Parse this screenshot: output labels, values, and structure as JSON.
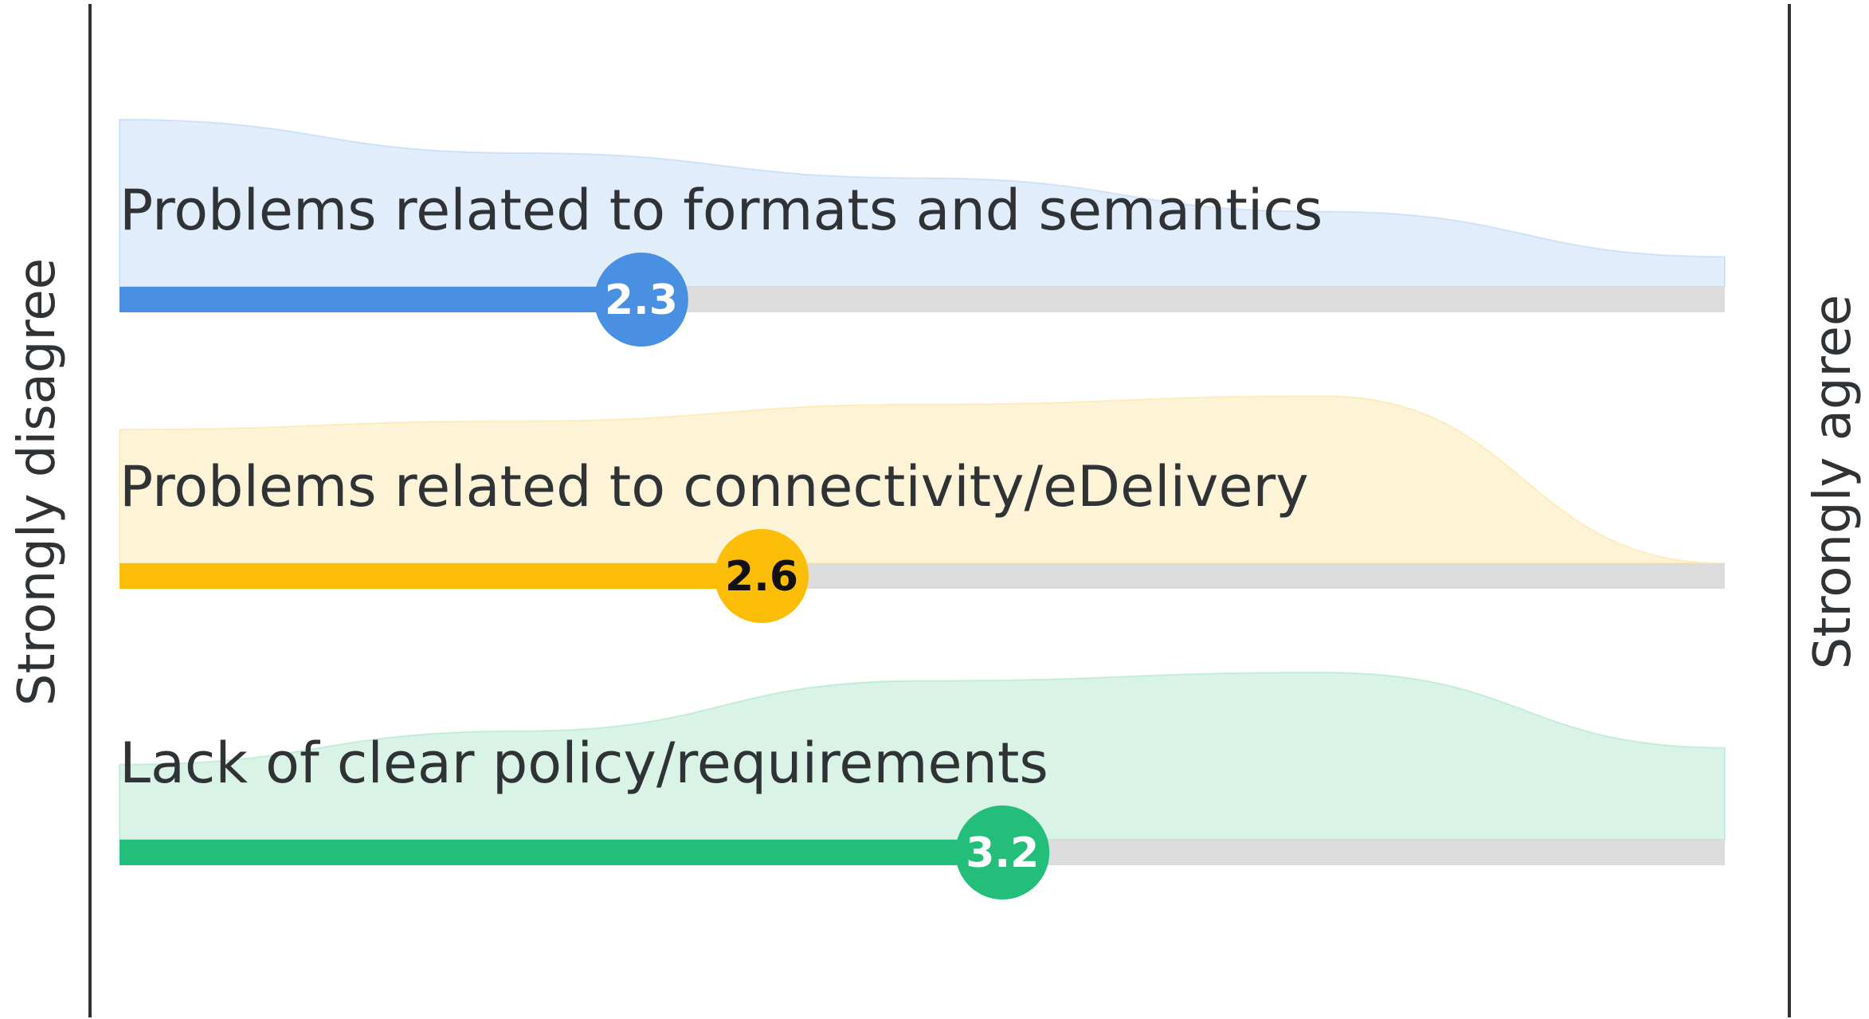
{
  "chart_data": {
    "type": "bar",
    "scale": {
      "min_label": "Strongly disagree",
      "max_label": "Strongly agree",
      "min": 1,
      "max": 5
    },
    "series": [
      {
        "label": "Problems related to formats and semantics",
        "value": 2.3,
        "value_label": "2.3",
        "color": "#4a90e2",
        "fill_color": "#e2edfb",
        "marker_text_color": "#ffffff",
        "distribution": [
          1.0,
          0.8,
          0.65,
          0.45,
          0.18
        ]
      },
      {
        "label": "Problems related to connectivity/eDelivery",
        "value": 2.6,
        "value_label": "2.6",
        "color": "#fbbd08",
        "fill_color": "#fdf3d6",
        "marker_text_color": "#111111",
        "distribution": [
          0.8,
          0.85,
          0.95,
          1.0,
          0.0
        ]
      },
      {
        "label": "Lack of clear policy/requirements",
        "value": 3.2,
        "value_label": "3.2",
        "color": "#23bf7a",
        "fill_color": "#d9f3e6",
        "marker_text_color": "#ffffff",
        "distribution": [
          0.45,
          0.65,
          0.95,
          1.0,
          0.55
        ]
      }
    ],
    "track_color": "#dcdcdc",
    "axis_color": "#2f3336"
  }
}
